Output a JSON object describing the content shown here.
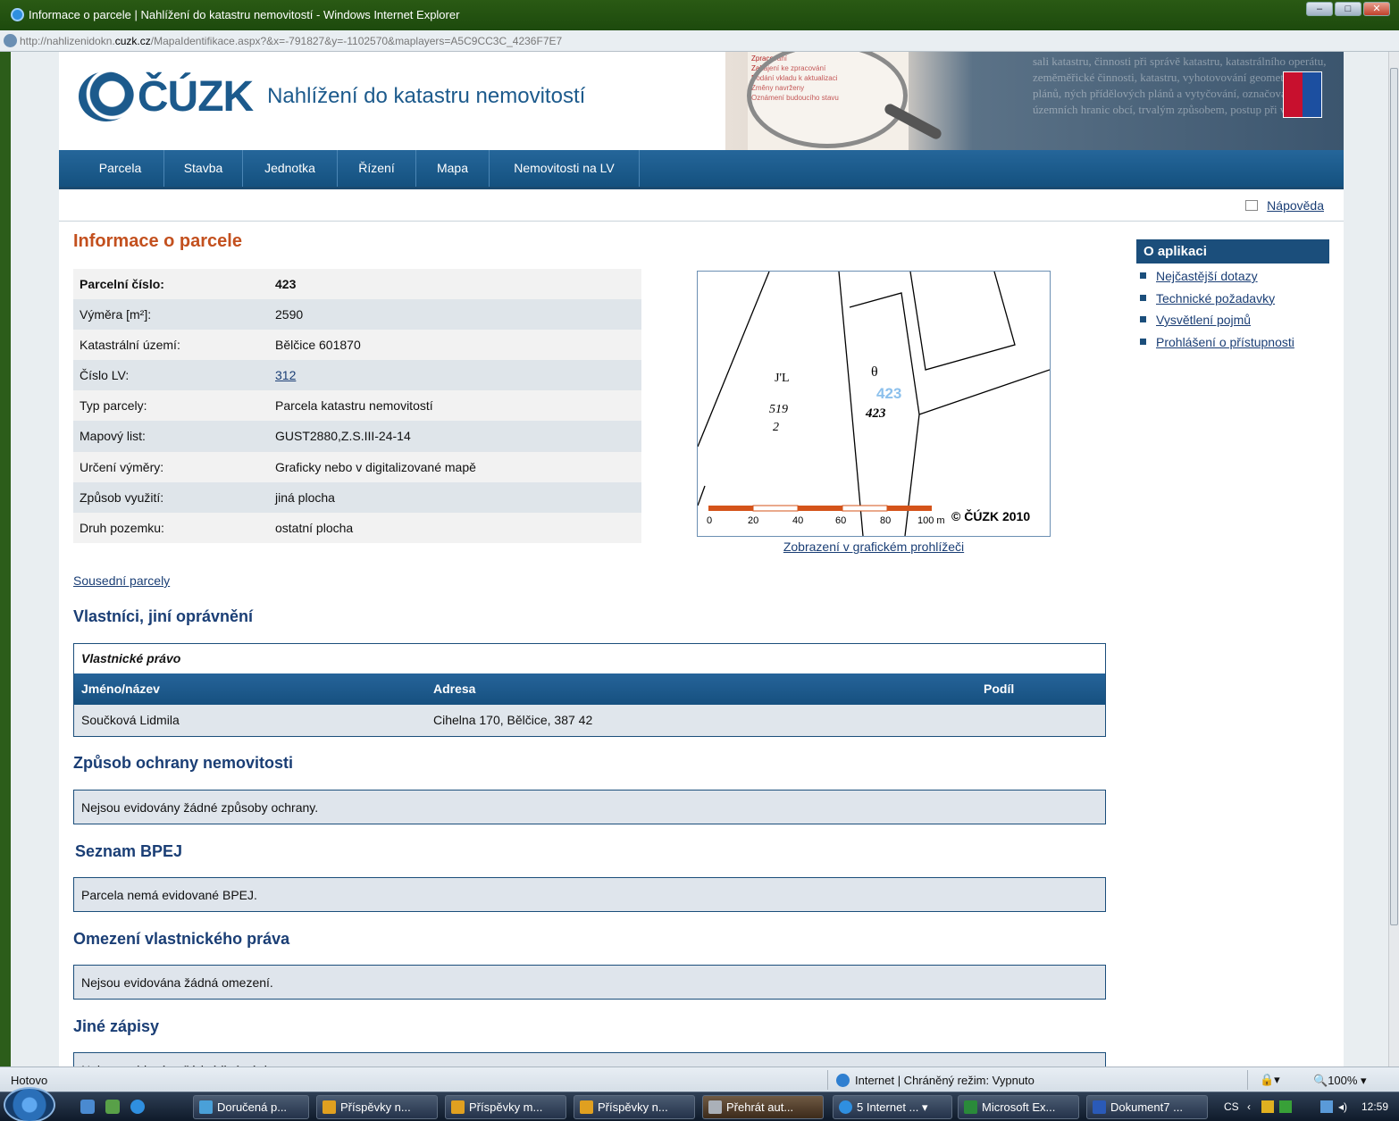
{
  "window": {
    "title": "Informace o parcele | Nahlížení do katastru nemovitostí - Windows Internet Explorer",
    "url_prefix": "http://nahlizenidokn.",
    "url_domain": "cuzk.cz",
    "url_rest": "/MapaIdentifikace.aspx?&x=-791827&y=-1102570&maplayers=A5C9CC3C_4236F7E7"
  },
  "header": {
    "logo_text": "ČÚZK",
    "app_title": "Nahlížení do katastru nemovitostí",
    "banner_list": [
      "Zpracování",
      "Zahájení ke zpracování",
      "Podání vkladu k aktualizaci",
      "Změny navrženy",
      "Oznámení budoucího stavu"
    ],
    "banner_text": "sali katastru, činnosti při správě katastru, katastrálního operátu, zeměměřické činnosti, katastru, vyhotovování geometrických plánů, ných přídělových plánů a vytyčování, označování územních hranic obcí, trvalým způsobem, postup při vkladu"
  },
  "nav": {
    "items": [
      "Parcela",
      "Stavba",
      "Jednotka",
      "Řízení",
      "Mapa",
      "Nemovitosti na LV"
    ]
  },
  "help_link": "Nápověda",
  "main": {
    "title": "Informace o parcele",
    "info": [
      {
        "label": "Parcelní číslo:",
        "value": "423"
      },
      {
        "label": "Výměra [m²]:",
        "value": "2590"
      },
      {
        "label": "Katastrální území:",
        "value": "Bělčice 601870"
      },
      {
        "label": "Číslo LV:",
        "value": "312"
      },
      {
        "label": "Typ parcely:",
        "value": "Parcela katastru nemovitostí"
      },
      {
        "label": "Mapový list:",
        "value": "GUST2880,Z.S.III-24-14"
      },
      {
        "label": "Určení výměry:",
        "value": "Graficky nebo v digitalizované mapě"
      },
      {
        "label": "Způsob využití:",
        "value": "jiná plocha"
      },
      {
        "label": "Druh pozemku:",
        "value": "ostatní plocha"
      }
    ],
    "map": {
      "parcel_label_blue": "423",
      "parcel_label_hand": "423",
      "label_a": "J'L",
      "label_b": "θ",
      "label_c": "519",
      "label_d": "2",
      "scale_ticks": [
        "0",
        "20",
        "40",
        "60",
        "80",
        "100 m"
      ],
      "copyright": "© ČÚZK 2010",
      "link": "Zobrazení v grafickém prohlížeči"
    },
    "neighbours_link": "Sousední parcely",
    "owners": {
      "title": "Vlastníci, jiní oprávnění",
      "caption": "Vlastnické právo",
      "headers": [
        "Jméno/název",
        "Adresa",
        "Podíl"
      ],
      "rows": [
        [
          "Součková Lidmila",
          "Cihelna 170, Bělčice, 387 42",
          ""
        ]
      ]
    },
    "protection": {
      "title": "Způsob ochrany nemovitosti",
      "text": "Nejsou evidovány žádné způsoby ochrany."
    },
    "bpej": {
      "title": "Seznam BPEJ",
      "text": "Parcela nemá evidované BPEJ."
    },
    "restrictions": {
      "title": "Omezení vlastnického práva",
      "text": "Nejsou evidována žádná omezení."
    },
    "other": {
      "title": "Jiné zápisy",
      "text": "Nejsou evidovány žádné jiné zápisy."
    }
  },
  "sidebar": {
    "title": "O aplikaci",
    "links": [
      "Nejčastější dotazy",
      "Technické požadavky",
      "Vysvětlení pojmů",
      "Prohlášení o přístupnosti"
    ]
  },
  "statusbar": {
    "status": "Hotovo",
    "zone": "Internet | Chráněný režim: Vypnuto",
    "zoom": "100%"
  },
  "taskbar": {
    "items": [
      "Doručená p...",
      "Příspěvky n...",
      "Příspěvky m...",
      "Příspěvky n...",
      "Přehrát aut...",
      "5 Internet ...",
      "Microsoft Ex...",
      "Dokument7 ..."
    ],
    "lang": "CS",
    "time": "12:59"
  }
}
